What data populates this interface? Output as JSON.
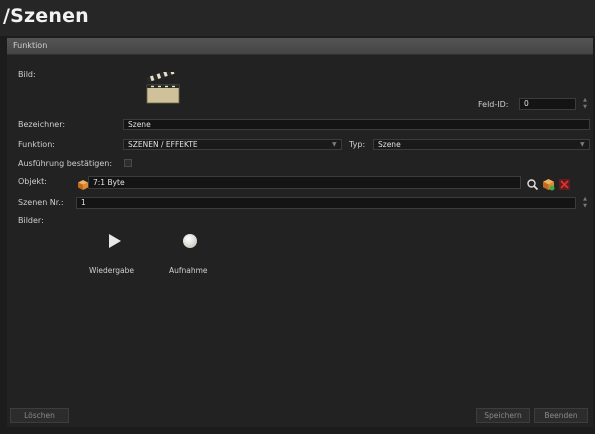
{
  "page": {
    "title": "/Szenen"
  },
  "section": {
    "header": "Funktion"
  },
  "form": {
    "bild_label": "Bild:",
    "feld_id_label": "Feld-ID:",
    "feld_id_value": "0",
    "bezeichner_label": "Bezeichner:",
    "bezeichner_value": "Szene",
    "funktion_label": "Funktion:",
    "funktion_value": "SZENEN / EFFEKTE",
    "typ_label": "Typ:",
    "typ_value": "Szene",
    "ausfuehrung_label": "Ausführung bestätigen:",
    "objekt_label": "Objekt:",
    "objekt_value": "7:1 Byte",
    "szenen_nr_label": "Szenen Nr.:",
    "szenen_nr_value": "1",
    "bilder_label": "Bilder:"
  },
  "bilder": [
    {
      "label": "Wiedergabe",
      "icon": "play-icon"
    },
    {
      "label": "Aufnahme",
      "icon": "record-icon"
    }
  ],
  "buttons": {
    "delete": "Löschen",
    "save": "Speichern",
    "quit": "Beenden"
  },
  "colors": {
    "background": "#1c1c1c",
    "panel": "#222222",
    "header": "#4c4c4c",
    "field": "#141414"
  }
}
